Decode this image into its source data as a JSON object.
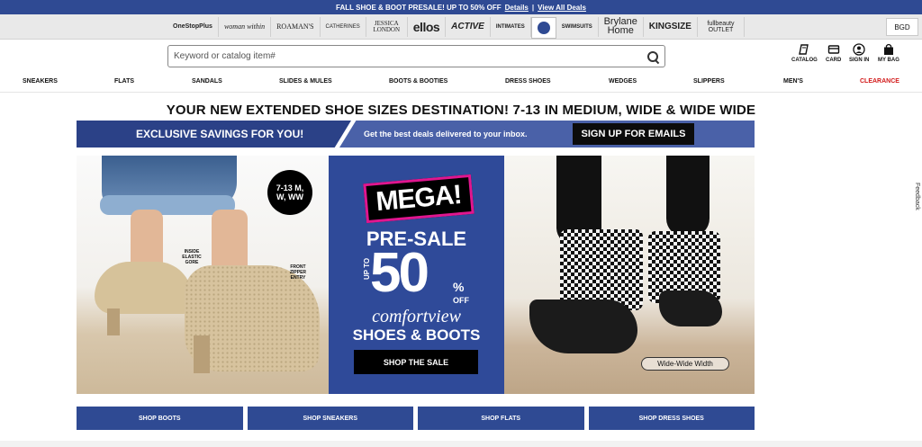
{
  "promo": {
    "text": "FALL SHOE & BOOT PRESALE! UP TO 50% OFF",
    "details_link": "Details",
    "separator": "|",
    "view_all_link": "View All Deals"
  },
  "brands": {
    "items": [
      "OneStopPlus",
      "woman within",
      "ROAMAN'S",
      "CATHERINES",
      "JESSICA LONDON",
      "ellos",
      "ACTIVE",
      "INTIMATES",
      "SWIMSUITS",
      "Brylane Home",
      "KINGSIZE",
      "fullbeauty OUTLET"
    ],
    "currency": "BGD"
  },
  "search": {
    "placeholder": "Keyword or catalog item#"
  },
  "utility": {
    "catalog": "CATALOG",
    "card": "CARD",
    "sign_in": "SIGN IN",
    "bag": "MY BAG"
  },
  "categories": [
    "SNEAKERS",
    "FLATS",
    "SANDALS",
    "SLIDES & MULES",
    "BOOTS & BOOTIES",
    "DRESS SHOES",
    "WEDGES",
    "SLIPPERS",
    "MEN'S",
    "CLEARANCE"
  ],
  "headline": "YOUR NEW EXTENDED SHOE SIZES DESTINATION! 7-13 IN MEDIUM, WIDE & WIDE WIDE",
  "email_banner": {
    "left": "EXCLUSIVE SAVINGS FOR YOU!",
    "middle": "Get the best deals delivered to your inbox.",
    "button": "SIGN UP FOR EMAILS"
  },
  "hero": {
    "badge_line1": "7-13 M,",
    "badge_line2": "W, WW",
    "callout_left": "INSIDE ELASTIC GORE",
    "callout_right": "FRONT ZIPPER ENTRY",
    "mega": "MEGA!",
    "presale": "PRE-SALE",
    "up_to": "UP TO",
    "percent_number": "50",
    "percent_sign": "%",
    "off": "OFF",
    "brand_line": "comfortview",
    "subline": "SHOES & BOOTS",
    "cta": "SHOP THE SALE",
    "width_tag": "Wide-Wide Width",
    "accent_color": "#2f4a99",
    "mega_border_color": "#e0168f"
  },
  "shop_buttons": [
    "SHOP BOOTS",
    "SHOP SNEAKERS",
    "SHOP FLATS",
    "SHOP DRESS SHOES"
  ],
  "feedback": "Feedback"
}
